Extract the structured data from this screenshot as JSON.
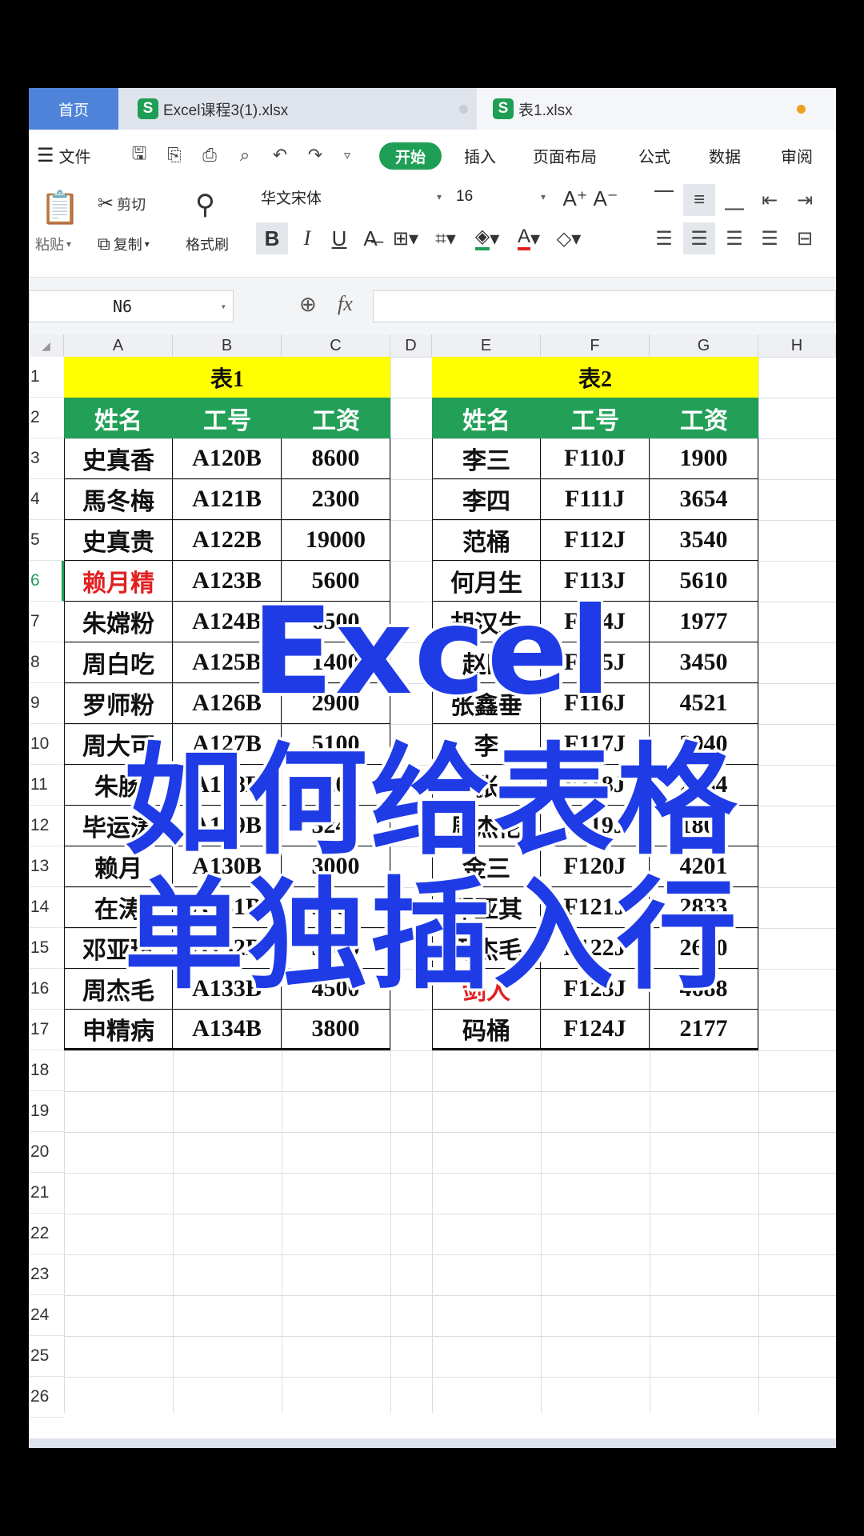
{
  "tabs": {
    "home": "首页",
    "file1": "Excel课程3(1).xlsx",
    "file2": "表1.xlsx",
    "sheet_icon": "S",
    "file1_dot_color": "#c8ccd4",
    "file2_dot_color": "#f0a020"
  },
  "menu": {
    "file": "文件",
    "start": "开始",
    "insert": "插入",
    "page_layout": "页面布局",
    "formula": "公式",
    "data": "数据",
    "review": "审阅",
    "quick_icons": [
      "save-icon",
      "export-icon",
      "print-icon",
      "preview-icon",
      "undo-icon",
      "redo-icon",
      "more-icon"
    ]
  },
  "ribbon": {
    "paste": "粘贴",
    "cut": "剪切",
    "copy": "复制",
    "format_painter": "格式刷",
    "font_name": "华文宋体",
    "font_size": "16",
    "bold": "B",
    "italic": "I",
    "underline": "U"
  },
  "formula_bar": {
    "name_box": "N6",
    "fx": "fx"
  },
  "columns": [
    "A",
    "B",
    "C",
    "D",
    "E",
    "F",
    "G",
    "H"
  ],
  "rows": [
    "1",
    "2",
    "3",
    "4",
    "5",
    "6",
    "7",
    "8",
    "9",
    "10",
    "11",
    "12",
    "13",
    "14",
    "15",
    "16",
    "17",
    "18",
    "19",
    "20",
    "21",
    "22",
    "23",
    "24",
    "25",
    "26"
  ],
  "table1": {
    "title": "表1",
    "headers": [
      "姓名",
      "工号",
      "工资"
    ],
    "rows": [
      [
        "史真香",
        "A120B",
        "8600"
      ],
      [
        "馬冬梅",
        "A121B",
        "2300"
      ],
      [
        "史真贵",
        "A122B",
        "19000"
      ],
      [
        "赖月精",
        "A123B",
        "5600"
      ],
      [
        "朱嫦粉",
        "A124B",
        "6500"
      ],
      [
        "周白吃",
        "A125B",
        "1400"
      ],
      [
        "罗师粉",
        "A126B",
        "2900"
      ],
      [
        "周大可",
        "A127B",
        "5100"
      ],
      [
        "朱肠",
        "A128B",
        "4200"
      ],
      [
        "毕运涛",
        "A129B",
        "3247"
      ],
      [
        "赖月",
        "A130B",
        "3000"
      ],
      [
        "在涛",
        "A131B",
        "3900"
      ],
      [
        "邓亚琪",
        "A132B",
        "3600"
      ],
      [
        "周杰毛",
        "A133B",
        "4500"
      ],
      [
        "申精病",
        "A134B",
        "3800"
      ]
    ],
    "red_row": 3
  },
  "table2": {
    "title": "表2",
    "headers": [
      "姓名",
      "工号",
      "工资"
    ],
    "rows": [
      [
        "李三",
        "F110J",
        "1900"
      ],
      [
        "李四",
        "F111J",
        "3654"
      ],
      [
        "范桶",
        "F112J",
        "3540"
      ],
      [
        "何月生",
        "F113J",
        "5610"
      ],
      [
        "胡汉生",
        "F114J",
        "1977"
      ],
      [
        "赵四",
        "F115J",
        "3450"
      ],
      [
        "张鑫垂",
        "F116J",
        "4521"
      ],
      [
        "李",
        "F117J",
        "3940"
      ],
      [
        "张",
        "F118J",
        "2584"
      ],
      [
        "周杰伦",
        "F119J",
        "1800"
      ],
      [
        "金三",
        "F120J",
        "4201"
      ],
      [
        "邓亚其",
        "F121J",
        "2833"
      ],
      [
        "周杰毛",
        "F122J",
        "2610"
      ],
      [
        "剑人",
        "F123J",
        "4688"
      ],
      [
        "码桶",
        "F124J",
        "2177"
      ]
    ],
    "red_row": 13
  },
  "overlay": {
    "line1": "Excel",
    "line2": "如何给表格",
    "line3": "单独插入行"
  },
  "colors": {
    "tab_home_bg": "#4f83d9",
    "brand_green": "#1f9e56",
    "header_green": "#23a057",
    "title_yellow": "#ffff00",
    "overlay_blue": "#1e3be6",
    "highlight_red": "#e02020"
  }
}
